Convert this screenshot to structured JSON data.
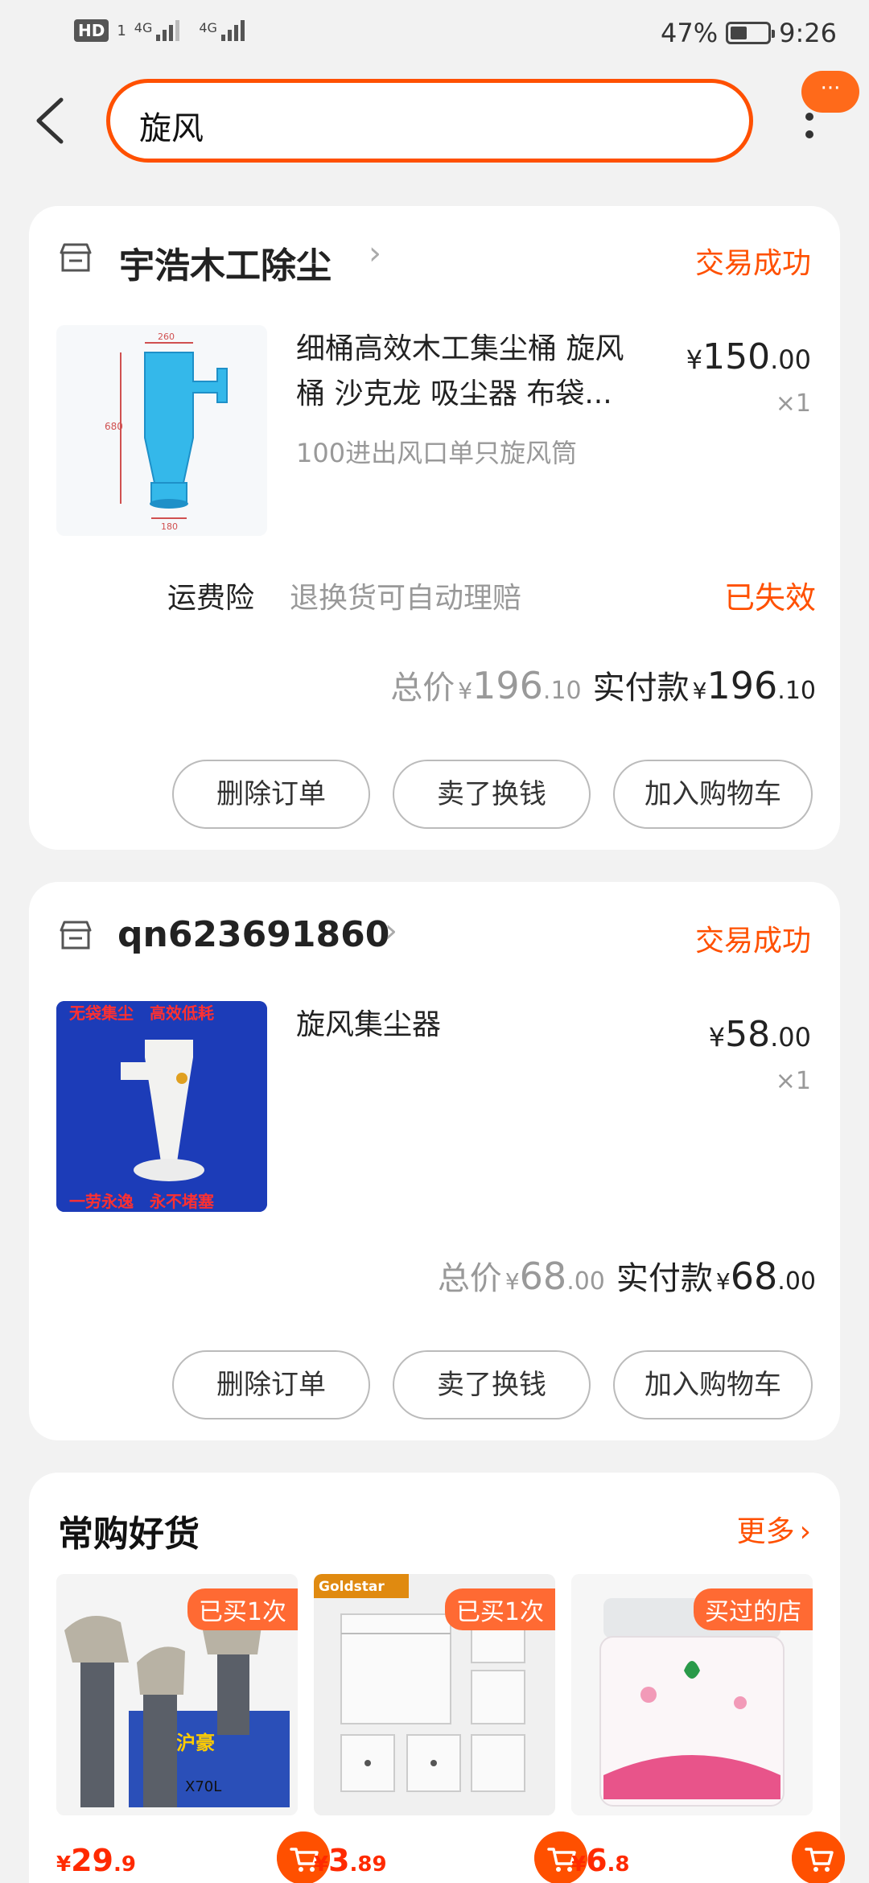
{
  "status_bar": {
    "hd": "HD",
    "sim1": "1",
    "net1": "4G",
    "net2": "4G",
    "battery": "47%",
    "time": "9:26"
  },
  "header": {
    "search_value": "旋风",
    "menu_badge": "···"
  },
  "orders": [
    {
      "shop_name": "宇浩木工除尘",
      "status": "交易成功",
      "title_line1": "细桶高效木工集尘桶 旋风",
      "title_line2": "桶 沙克龙 吸尘器 布袋...",
      "sku": "100进出风口单只旋风筒",
      "price_symbol": "¥",
      "price_int": "150",
      "price_dec": ".00",
      "qty": "×1",
      "insurance_label": "运费险",
      "insurance_desc": "退换货可自动理赔",
      "insurance_status": "已失效",
      "total_label": "总价",
      "total_symbol": "¥",
      "total_int": "196",
      "total_dec": ".10",
      "paid_label": "实付款",
      "paid_symbol": "¥",
      "paid_int": "196",
      "paid_dec": ".10",
      "buttons": [
        "删除订单",
        "卖了换钱",
        "加入购物车"
      ]
    },
    {
      "shop_name": "qn623691860",
      "status": "交易成功",
      "title_line1": "旋风集尘器",
      "price_symbol": "¥",
      "price_int": "58",
      "price_dec": ".00",
      "qty": "×1",
      "image_text_top": "无袋集尘　高效低耗",
      "image_text_bottom": "一劳永逸　永不堵塞",
      "total_label": "总价",
      "total_symbol": "¥",
      "total_int": "68",
      "total_dec": ".00",
      "paid_label": "实付款",
      "paid_symbol": "¥",
      "paid_int": "68",
      "paid_dec": ".00",
      "buttons": [
        "删除订单",
        "卖了换钱",
        "加入购物车"
      ]
    }
  ],
  "recommend": {
    "title": "常购好货",
    "more": "更多",
    "items": [
      {
        "tag": "已买1次",
        "sym": "¥",
        "int": "29",
        "dec": ".9",
        "img_text": "AO沪豪",
        "img_text2": "X70L"
      },
      {
        "tag": "已买1次",
        "sym": "¥",
        "int": "3",
        "dec": ".89",
        "img_text": "Goldstar"
      },
      {
        "tag": "买过的店",
        "sym": "¥",
        "int": "6",
        "dec": ".8"
      }
    ]
  }
}
